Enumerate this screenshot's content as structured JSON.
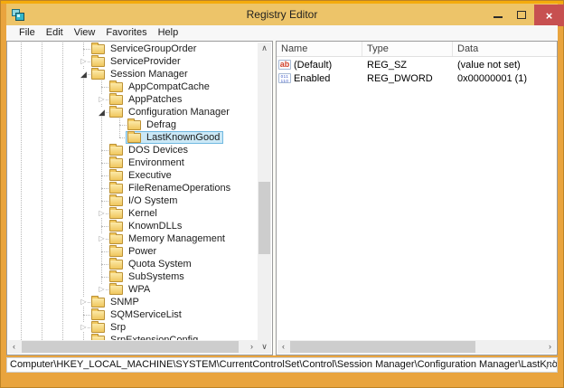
{
  "window": {
    "title": "Registry Editor"
  },
  "icons": {
    "close_glyph": "×",
    "collapsed_glyph": "▷",
    "expanded_glyph": "◢",
    "scroll_up": "∧",
    "scroll_down": "∨",
    "scroll_left": "‹",
    "scroll_right": "›",
    "string_glyph": "ab",
    "dword_glyph": "011\n110"
  },
  "menu": {
    "items": [
      "File",
      "Edit",
      "View",
      "Favorites",
      "Help"
    ]
  },
  "tree": {
    "items": [
      {
        "label": "ServiceGroupOrder",
        "level": 0,
        "expander": "none",
        "selected": false
      },
      {
        "label": "ServiceProvider",
        "level": 0,
        "expander": "collapsed",
        "selected": false
      },
      {
        "label": "Session Manager",
        "level": 0,
        "expander": "expanded",
        "selected": false
      },
      {
        "label": "AppCompatCache",
        "level": 1,
        "expander": "none",
        "selected": false
      },
      {
        "label": "AppPatches",
        "level": 1,
        "expander": "collapsed",
        "selected": false
      },
      {
        "label": "Configuration Manager",
        "level": 1,
        "expander": "expanded",
        "selected": false
      },
      {
        "label": "Defrag",
        "level": 2,
        "expander": "none",
        "selected": false
      },
      {
        "label": "LastKnownGood",
        "level": 2,
        "expander": "none",
        "selected": true
      },
      {
        "label": "DOS Devices",
        "level": 1,
        "expander": "none",
        "selected": false
      },
      {
        "label": "Environment",
        "level": 1,
        "expander": "none",
        "selected": false
      },
      {
        "label": "Executive",
        "level": 1,
        "expander": "none",
        "selected": false
      },
      {
        "label": "FileRenameOperations",
        "level": 1,
        "expander": "none",
        "selected": false
      },
      {
        "label": "I/O System",
        "level": 1,
        "expander": "none",
        "selected": false
      },
      {
        "label": "Kernel",
        "level": 1,
        "expander": "collapsed",
        "selected": false
      },
      {
        "label": "KnownDLLs",
        "level": 1,
        "expander": "none",
        "selected": false
      },
      {
        "label": "Memory Management",
        "level": 1,
        "expander": "collapsed",
        "selected": false
      },
      {
        "label": "Power",
        "level": 1,
        "expander": "none",
        "selected": false
      },
      {
        "label": "Quota System",
        "level": 1,
        "expander": "none",
        "selected": false
      },
      {
        "label": "SubSystems",
        "level": 1,
        "expander": "none",
        "selected": false
      },
      {
        "label": "WPA",
        "level": 1,
        "expander": "collapsed",
        "selected": false
      },
      {
        "label": "SNMP",
        "level": 0,
        "expander": "collapsed",
        "selected": false
      },
      {
        "label": "SQMServiceList",
        "level": 0,
        "expander": "none",
        "selected": false
      },
      {
        "label": "Srp",
        "level": 0,
        "expander": "collapsed",
        "selected": false
      },
      {
        "label": "SrpExtensionConfig",
        "level": 0,
        "expander": "none",
        "selected": false
      }
    ]
  },
  "values": {
    "columns": [
      "Name",
      "Type",
      "Data"
    ],
    "rows": [
      {
        "icon": "string-value-icon",
        "name": "(Default)",
        "type": "REG_SZ",
        "data": "(value not set)"
      },
      {
        "icon": "dword-value-icon",
        "name": "Enabled",
        "type": "REG_DWORD",
        "data": "0x00000001 (1)"
      }
    ]
  },
  "statusbar": {
    "path": "Computer\\HKEY_LOCAL_MACHINE\\SYSTEM\\CurrentControlSet\\Control\\Session Manager\\Configuration Manager\\LastKnownGood"
  },
  "colors": {
    "frame": "#E9A43E",
    "frame_top": "#F5AB0C",
    "titlebar": "#EDC469",
    "close_button": "#C75050",
    "selection_fill": "#CBE8F6",
    "selection_border": "#70B8E0",
    "folder": "#F0C75E"
  }
}
